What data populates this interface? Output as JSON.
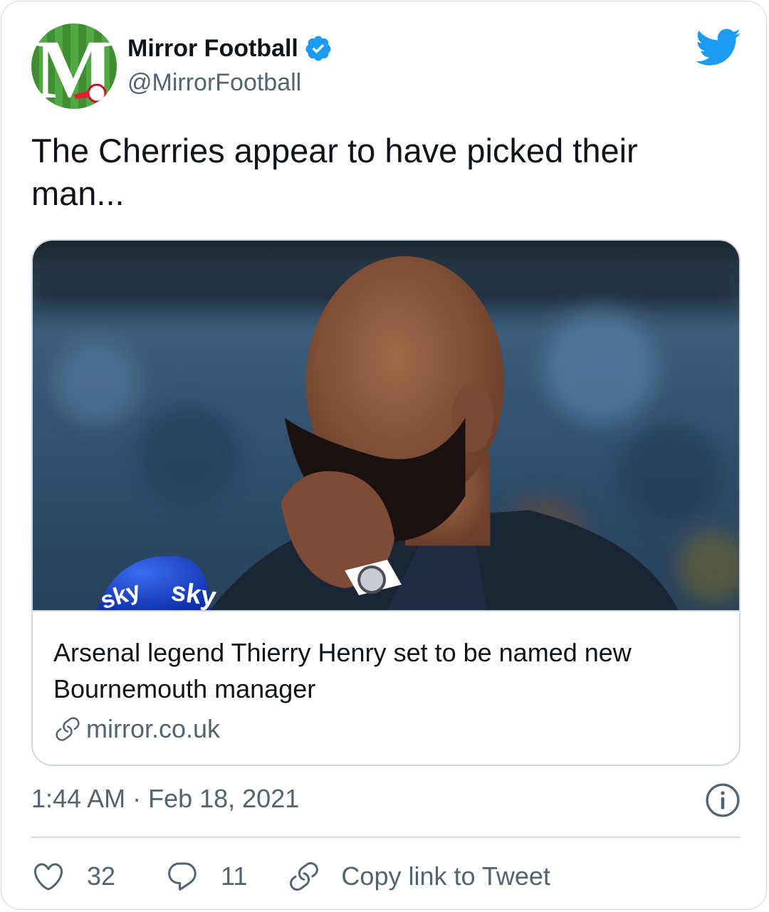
{
  "author": {
    "name": "Mirror Football",
    "handle": "@MirrorFootball",
    "verified": true,
    "avatar_icon": "mirror-football-logo",
    "avatar_letter": "M"
  },
  "tweet": {
    "text": "The Cherries appear to have picked their man..."
  },
  "link_card": {
    "title": "Arsenal legend Thierry Henry set to be named new Bournemouth manager",
    "domain": "mirror.co.uk",
    "image_text_left": "sky",
    "image_text_right": "sky"
  },
  "timestamp": "1:44 AM · Feb 18, 2021",
  "actions": {
    "like_count": "32",
    "reply_count": "11",
    "copy_link_label": "Copy link to Tweet"
  },
  "colors": {
    "twitter_blue": "#1d9bf0",
    "text_primary": "#0f1419",
    "text_secondary": "#536471",
    "border": "#cfd9de"
  }
}
